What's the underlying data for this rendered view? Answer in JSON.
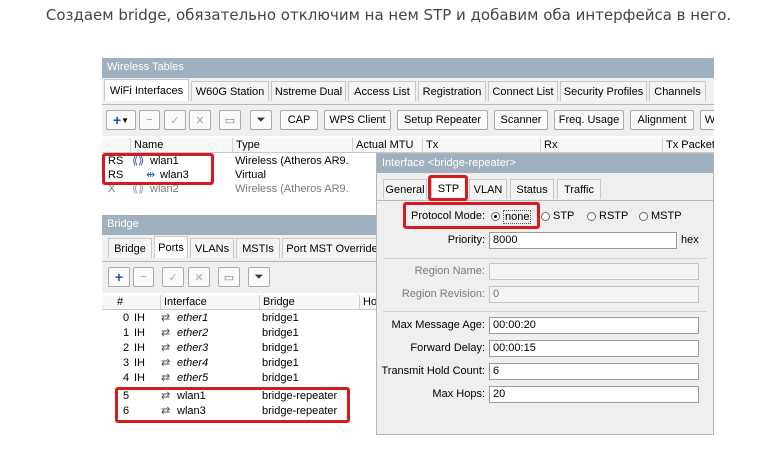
{
  "caption": "Создаем bridge, обязательно отключим на нем STP и добавим оба интерфейса в него.",
  "wireless": {
    "title": "Wireless Tables",
    "tabs": [
      "WiFi Interfaces",
      "W60G Station",
      "Nstreme Dual",
      "Access List",
      "Registration",
      "Connect List",
      "Security Profiles",
      "Channels"
    ],
    "toolbar": [
      "CAP",
      "WPS Client",
      "Setup Repeater",
      "Scanner",
      "Freq. Usage",
      "Alignment",
      "W"
    ],
    "columns": [
      "Name",
      "Type",
      "Actual MTU",
      "Tx",
      "Rx",
      "Tx Packet"
    ],
    "rows": [
      {
        "flag": "RS",
        "name": "wlan1",
        "type": "Wireless (Atheros AR9..."
      },
      {
        "flag": "RS",
        "name": "wlan3",
        "type": "Virtual"
      },
      {
        "flag": "X",
        "name": "wlan2",
        "type": "Wireless (Atheros AR9..."
      }
    ]
  },
  "bridge": {
    "title": "Bridge",
    "tabs": [
      "Bridge",
      "Ports",
      "VLANs",
      "MSTIs",
      "Port MST Override"
    ],
    "columns": [
      "#",
      "Interface",
      "Bridge",
      "Ho"
    ],
    "rows": [
      {
        "num": "0",
        "flag": "IH",
        "iface": "ether1",
        "bridge": "bridge1"
      },
      {
        "num": "1",
        "flag": "IH",
        "iface": "ether2",
        "bridge": "bridge1"
      },
      {
        "num": "2",
        "flag": "IH",
        "iface": "ether3",
        "bridge": "bridge1"
      },
      {
        "num": "3",
        "flag": "IH",
        "iface": "ether4",
        "bridge": "bridge1"
      },
      {
        "num": "4",
        "flag": "IH",
        "iface": "ether5",
        "bridge": "bridge1"
      },
      {
        "num": "5",
        "flag": "",
        "iface": "wlan1",
        "bridge": "bridge-repeater"
      },
      {
        "num": "6",
        "flag": "",
        "iface": "wlan3",
        "bridge": "bridge-repeater"
      }
    ]
  },
  "iface_dialog": {
    "title": "Interface <bridge-repeater>",
    "tabs": [
      "General",
      "STP",
      "VLAN",
      "Status",
      "Traffic"
    ],
    "protocol_mode_label": "Protocol Mode:",
    "protocol_options": [
      "none",
      "STP",
      "RSTP",
      "MSTP"
    ],
    "protocol_selected": "none",
    "priority_label": "Priority:",
    "priority_value": "8000",
    "priority_unit": "hex",
    "region_name_label": "Region Name:",
    "region_name_value": "",
    "region_revision_label": "Region Revision:",
    "region_revision_value": "0",
    "max_message_age_label": "Max Message Age:",
    "max_message_age_value": "00:00:20",
    "forward_delay_label": "Forward Delay:",
    "forward_delay_value": "00:00:15",
    "transmit_hold_count_label": "Transmit Hold Count:",
    "transmit_hold_count_value": "6",
    "max_hops_label": "Max Hops:",
    "max_hops_value": "20"
  },
  "colors": {
    "highlight": "#d71920",
    "title_bar": "#9fb0bf",
    "panel": "#efefef"
  }
}
